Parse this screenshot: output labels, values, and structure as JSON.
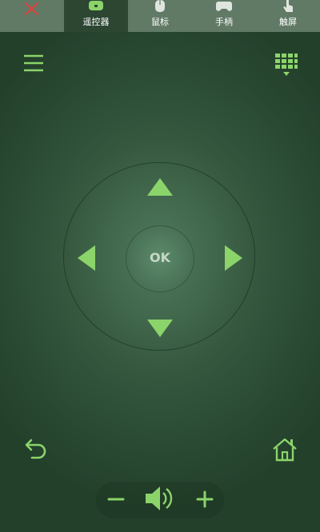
{
  "tabs": [
    {
      "label": "遥控器",
      "icon": "remote-icon",
      "active": true
    },
    {
      "label": "鼠标",
      "icon": "mouse-icon",
      "active": false
    },
    {
      "label": "手柄",
      "icon": "gamepad-icon",
      "active": false
    },
    {
      "label": "触屏",
      "icon": "touch-icon",
      "active": false
    }
  ],
  "dpad": {
    "ok_label": "OK"
  },
  "colors": {
    "accent_green": "#8bd46a",
    "close_red": "#e0433e",
    "tabbar_bg": "#617a66",
    "active_tab_bg": "#2c4632",
    "background": "#2f5038"
  }
}
